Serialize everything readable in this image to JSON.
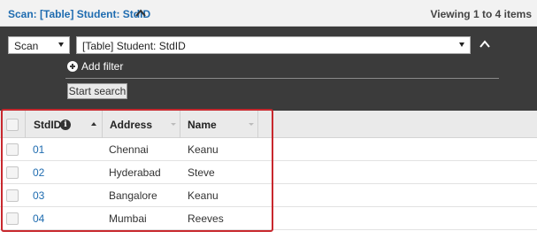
{
  "header": {
    "title": "Scan: [Table] Student: StdID",
    "viewing": "Viewing 1 to 4 items",
    "collapse_icon": "chevron-up-icon"
  },
  "search": {
    "mode": "Scan",
    "target": "[Table] Student: StdID",
    "add_filter": "Add filter",
    "start_search": "Start search"
  },
  "table": {
    "columns": [
      "StdID",
      "Address",
      "Name"
    ],
    "rows": [
      {
        "StdID": "01",
        "Address": "Chennai",
        "Name": "Keanu"
      },
      {
        "StdID": "02",
        "Address": "Hyderabad",
        "Name": "Steve"
      },
      {
        "StdID": "03",
        "Address": "Bangalore",
        "Name": "Keanu"
      },
      {
        "StdID": "04",
        "Address": "Mumbai",
        "Name": "Reeves"
      }
    ]
  },
  "colors": {
    "link": "#1f6cb0",
    "panel": "#3b3b3b",
    "highlight": "#c8282e"
  }
}
